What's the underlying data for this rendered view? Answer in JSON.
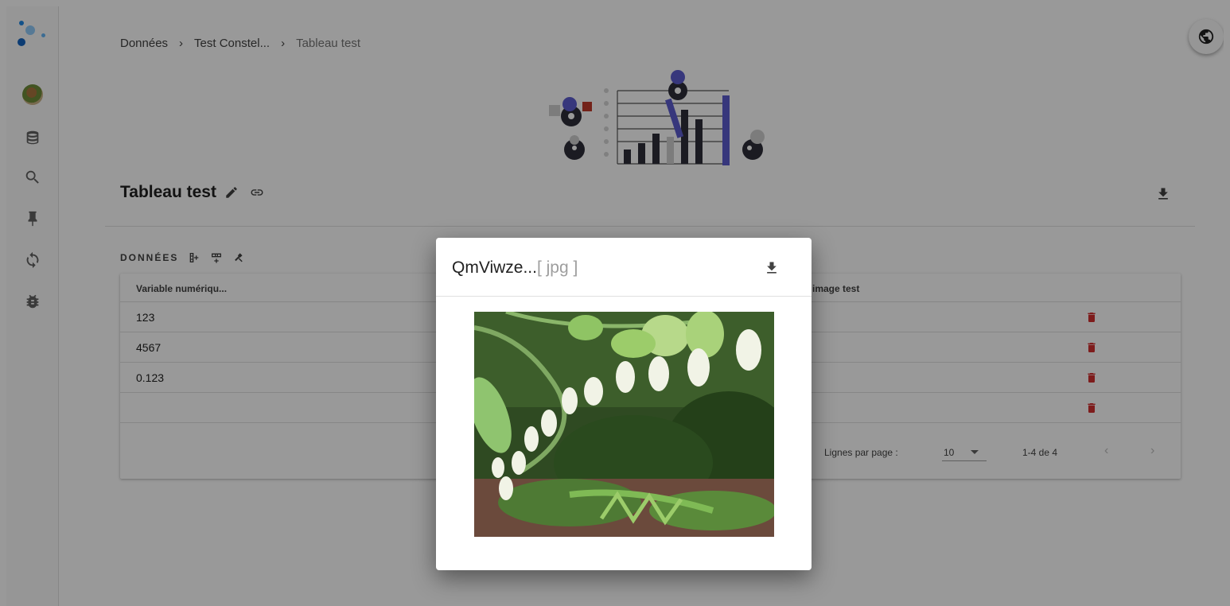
{
  "breadcrumb": {
    "items": [
      "Données",
      "Test Constel...",
      "Tableau test"
    ],
    "separator": "›"
  },
  "page": {
    "title": "Tableau test"
  },
  "data_section": {
    "title": "DONNÉES"
  },
  "table": {
    "columns": [
      "Variable numériqu...",
      "image test"
    ],
    "rows": [
      {
        "value": "123"
      },
      {
        "value": "4567"
      },
      {
        "value": "0.123"
      },
      {
        "value": ""
      }
    ]
  },
  "pagination": {
    "rows_per_page_label": "Lignes par page :",
    "rows_per_page_value": "10",
    "range": "1-4 de 4",
    "prev": "‹",
    "next": "›"
  },
  "dialog": {
    "filename": "QmViwze...",
    "extension": "[ jpg ]"
  },
  "icons": {
    "sidebar": [
      "logo-icon",
      "avatar",
      "database-icon",
      "search-icon",
      "pin-icon",
      "sync-icon",
      "bug-icon"
    ],
    "globe": "globe-icon",
    "download": "download-icon",
    "edit": "pencil-icon",
    "link": "link-icon",
    "delete": "trash-icon"
  },
  "colors": {
    "accent": "#5c5ccf",
    "delete": "#d32f2f",
    "logo_blue": "#2196f3"
  }
}
